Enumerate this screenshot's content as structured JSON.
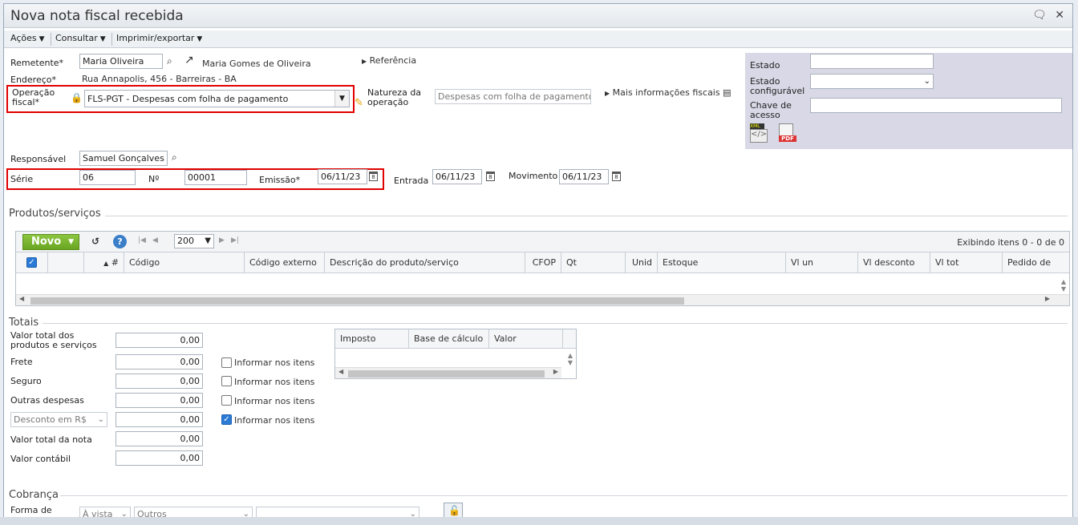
{
  "window": {
    "title": "Nova nota fiscal recebida"
  },
  "menubar": {
    "acoes": "Ações",
    "consultar": "Consultar",
    "imprimir": "Imprimir/exportar"
  },
  "header": {
    "remetente_label": "Remetente*",
    "remetente_value": "Maria Oliveira",
    "remetente_name": "Maria Gomes de Oliveira",
    "referencia": "Referência",
    "endereco_label": "Endereço*",
    "endereco_value": "Rua Annapolis, 456 - Barreiras - BA",
    "operacao_label_1": "Operação",
    "operacao_label_2": "fiscal*",
    "operacao_value": "FLS-PGT - Despesas com folha de pagamento",
    "natureza_label_1": "Natureza da",
    "natureza_label_2": "operação",
    "natureza_value": "Despesas com folha de pagamento",
    "mais_info": "Mais informações fiscais",
    "responsavel_label": "Responsável",
    "responsavel_value": "Samuel Gonçalves",
    "serie_label": "Série",
    "serie_value": "06",
    "numero_label": "Nº",
    "numero_value": "00001",
    "emissao_label": "Emissão*",
    "emissao_value": "06/11/23",
    "entrada_label": "Entrada",
    "entrada_value": "06/11/23",
    "movimento_label": "Movimento",
    "movimento_value": "06/11/23"
  },
  "right_panel": {
    "estado_label": "Estado",
    "estado_conf_label_1": "Estado",
    "estado_conf_label_2": "configurável",
    "chave_label_1": "Chave de",
    "chave_label_2": "acesso",
    "xml_label": "XML",
    "pdf_label": "PDF"
  },
  "produtos": {
    "title": "Produtos/serviços",
    "novo": "Novo",
    "page_size": "200",
    "exibindo": "Exibindo itens 0 - 0 de 0",
    "columns": [
      "#",
      "Código",
      "Código externo",
      "Descrição do produto/serviço",
      "CFOP",
      "Qt",
      "Unid",
      "Estoque",
      "Vl un",
      "Vl desconto",
      "Vl tot",
      "Pedido de"
    ]
  },
  "totais": {
    "title": "Totais",
    "valor_total_prod_1": "Valor total dos",
    "valor_total_prod_2": "produtos e serviços",
    "valor_total_prod": "0,00",
    "frete_label": "Frete",
    "frete": "0,00",
    "seguro_label": "Seguro",
    "seguro": "0,00",
    "outras_label": "Outras despesas",
    "outras": "0,00",
    "desconto_select": "Desconto em R$",
    "desconto": "0,00",
    "valor_nota_label": "Valor total da nota",
    "valor_nota": "0,00",
    "valor_contabil_label": "Valor contábil",
    "valor_contabil": "0,00",
    "informar": "Informar nos itens",
    "imposto_cols": [
      "Imposto",
      "Base de cálculo",
      "Valor"
    ]
  },
  "cobranca": {
    "title": "Cobrança",
    "forma_label": "Forma de",
    "avista": "À vista",
    "outros": "Outros"
  }
}
